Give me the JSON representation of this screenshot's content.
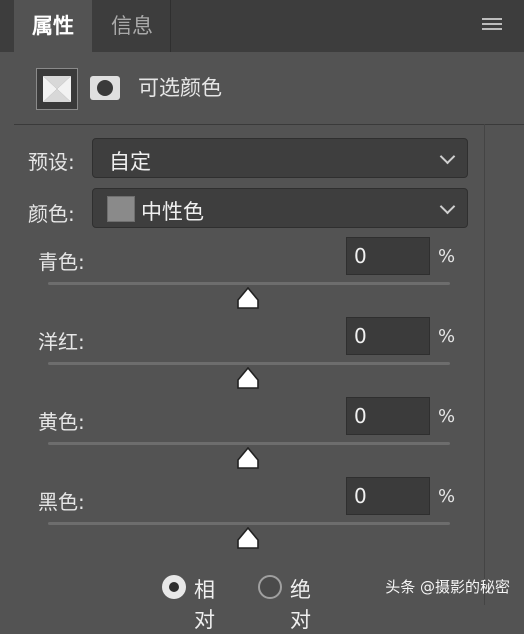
{
  "tabs": [
    {
      "label": "属性",
      "active": true
    },
    {
      "label": "信息",
      "active": false
    }
  ],
  "header": {
    "title": "可选颜色"
  },
  "preset": {
    "label": "预设:",
    "value": "自定"
  },
  "color": {
    "label": "颜色:",
    "value": "中性色",
    "swatch_color": "#8a8a8a"
  },
  "sliders": [
    {
      "label": "青色:",
      "value": "0",
      "unit": "%",
      "level": 0
    },
    {
      "label": "洋红:",
      "value": "0",
      "unit": "%",
      "level": 0
    },
    {
      "label": "黄色:",
      "value": "0",
      "unit": "%",
      "level": 0
    },
    {
      "label": "黑色:",
      "value": "0",
      "unit": "%",
      "level": 0
    }
  ],
  "method": {
    "options": [
      {
        "label": "相对",
        "selected": true
      },
      {
        "label": "绝对",
        "selected": false
      }
    ]
  },
  "watermark": "头条 @摄影的秘密"
}
